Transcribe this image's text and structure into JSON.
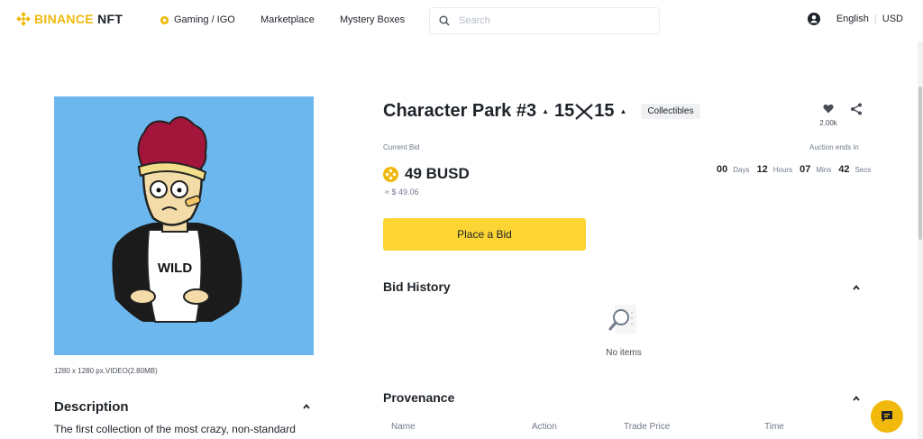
{
  "header": {
    "logo_primary": "BINANCE",
    "logo_secondary": "NFT",
    "nav": [
      "Gaming / IGO",
      "Marketplace",
      "Mystery Boxes"
    ],
    "search_placeholder": "Search",
    "language": "English",
    "currency": "USD"
  },
  "artwork": {
    "shirt_text": "WILD",
    "meta": "1280 x 1280 px.VIDEO(2.80MB)"
  },
  "description": {
    "title": "Description",
    "text": "The first collection of the most crazy, non-standard"
  },
  "item": {
    "title": "Character Park #3",
    "edition_a": "15",
    "edition_b": "15",
    "category": "Collectibles",
    "favorites": "2.00k"
  },
  "auction": {
    "current_bid_label": "Current Bid",
    "bid_value": "49 BUSD",
    "usd_value": "≈ $ 49.06",
    "ends_label": "Auction ends in",
    "countdown": [
      {
        "num": "00",
        "unit": "Days"
      },
      {
        "num": "12",
        "unit": "Hours"
      },
      {
        "num": "07",
        "unit": "Mins"
      },
      {
        "num": "42",
        "unit": "Secs"
      }
    ],
    "bid_button": "Place a Bid"
  },
  "bid_history": {
    "title": "Bid History",
    "empty": "No items"
  },
  "provenance": {
    "title": "Provenance",
    "columns": [
      "Name",
      "Action",
      "Trade Price",
      "Time"
    ]
  },
  "colors": {
    "brand": "#F0B90B",
    "button": "#FCD535",
    "art_bg": "#6CB8EE"
  }
}
